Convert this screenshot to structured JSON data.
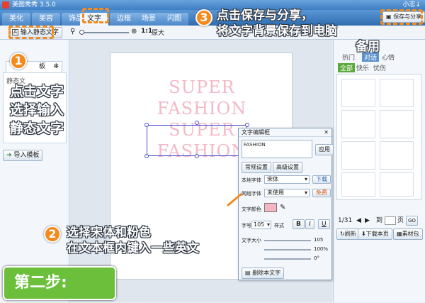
{
  "window": {
    "title": "美图秀秀 3.5.0",
    "user": "小志↓"
  },
  "tabs": [
    {
      "label": "美化"
    },
    {
      "label": "美容"
    },
    {
      "label": "饰品"
    },
    {
      "label": "文字"
    },
    {
      "label": "边框"
    },
    {
      "label": "场景"
    },
    {
      "label": "闪图"
    }
  ],
  "toolbar": {
    "input_static_text": "输入静态文字",
    "zoom_ratio": "1:1",
    "zoom_max": "原大",
    "save_share": "保存与分享"
  },
  "left_panel": {
    "tab_label": "板",
    "section_label": "静态文",
    "import_template": "导入模板"
  },
  "canvas": {
    "lines": [
      "SUPER",
      "FASHION",
      "SUPER",
      "FASHION"
    ]
  },
  "dialog": {
    "title": "文字编辑框",
    "text_value": "FASHION",
    "apply_label": "应用",
    "tabs": [
      "常规设置",
      "高级设置"
    ],
    "local_font_label": "本地字体",
    "local_font_value": "宋体",
    "download_label": "下载",
    "web_font_label": "网络字体",
    "web_font_value": "未使用",
    "free_label": "免费",
    "color_label": "文字颜色",
    "color": "#f4b6c2",
    "size_label": "字号",
    "size_value": "105",
    "style_label": "样式",
    "style_buttons": [
      "B",
      "I",
      "U"
    ],
    "font_size_label": "文字大小",
    "font_size_value": "105",
    "opacity_value": "100%",
    "rotation_value": "0°",
    "delete_label": "删除本文字"
  },
  "right_panel": {
    "tabs": [
      "热门",
      "对话",
      "心情"
    ],
    "filters": [
      "全部",
      "快乐",
      "忧伤"
    ],
    "page_info": "1/31",
    "page_go_label": "到",
    "page_input": "页",
    "go_button": "GO",
    "refresh": "刷新",
    "download_page": "下载本页",
    "material_pack": "素材包"
  },
  "annotations": {
    "step1_num": "1",
    "step1_lines": [
      "点击文字",
      "选择输入",
      "静态文字"
    ],
    "step2_num": "2",
    "step2_lines": [
      "选择宋体和粉色",
      "在文本框内键入一些英文"
    ],
    "step3_num": "3",
    "step3_lines": [
      "点击保存与分享，",
      "将文字背景保存到电脑",
      "备用"
    ],
    "step_badge": "第二步:"
  },
  "colors": {
    "accent": "#f48a1b",
    "badge": "#6bbf3a",
    "text_pink": "#f2b9c7"
  }
}
